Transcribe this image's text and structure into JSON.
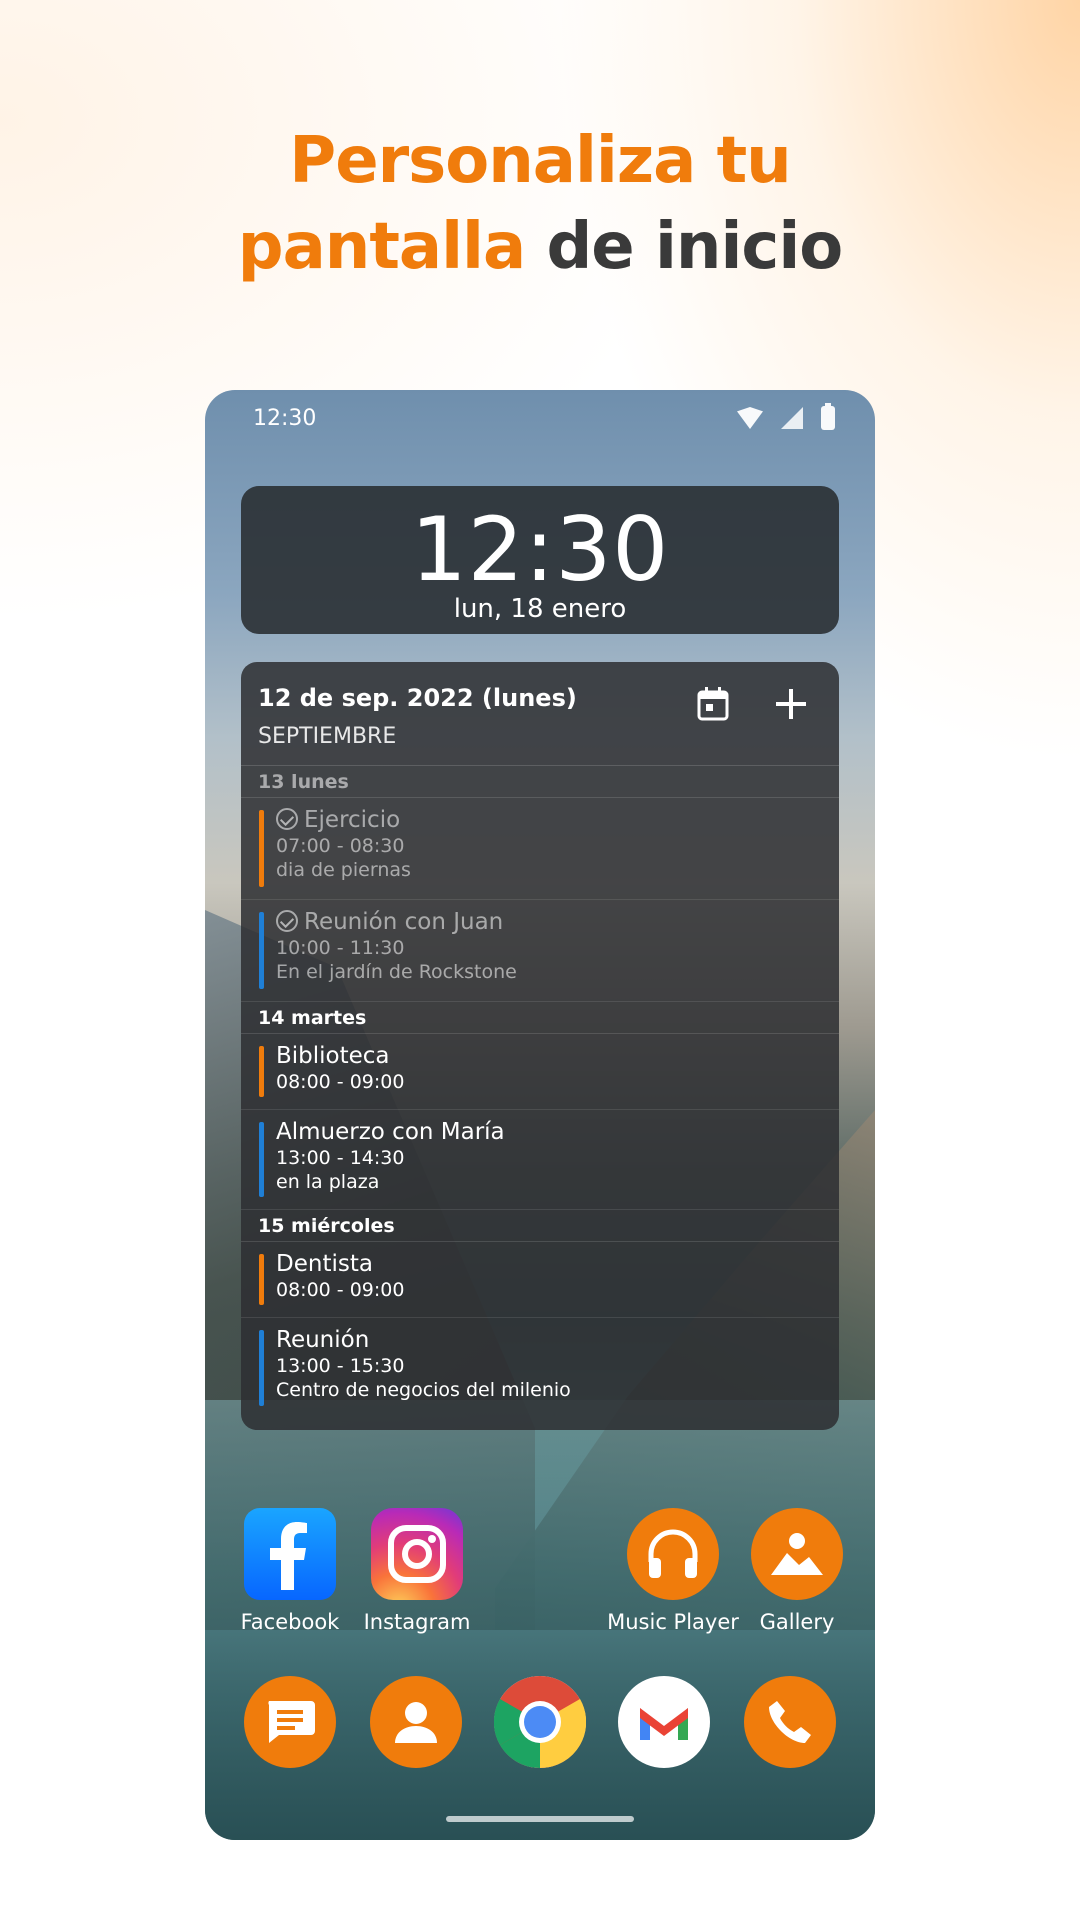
{
  "headline": {
    "line1_orange": "Personaliza tu",
    "line2_orange": "pantalla",
    "line2_dark": "de inicio"
  },
  "colors": {
    "accent": "#f07c0c",
    "dark_text": "#3a3a3a",
    "event_orange": "#f07c0c",
    "event_blue": "#1f7fd6"
  },
  "status_bar": {
    "time": "12:30",
    "icons": [
      "wifi-icon",
      "signal-icon",
      "battery-icon"
    ]
  },
  "clock_widget": {
    "time": "12:30",
    "date": "lun, 18 enero"
  },
  "calendar": {
    "title": "12 de sep. 2022 (lunes)",
    "month": "SEPTIEMBRE",
    "days": [
      {
        "label": "13 lunes",
        "events": [
          {
            "title": "Ejercicio",
            "time": "07:00 - 08:30",
            "note": "dia de piernas",
            "completed": true
          },
          {
            "title": "Reunión con Juan",
            "time": "10:00 - 11:30",
            "note": "En el jardín de Rockstone",
            "completed": true
          }
        ]
      },
      {
        "label": "14 martes",
        "events": [
          {
            "title": "Biblioteca",
            "time": "08:00 - 09:00",
            "note": ""
          },
          {
            "title": "Almuerzo con María",
            "time": "13:00 - 14:30",
            "note": "en la plaza"
          }
        ]
      },
      {
        "label": "15 miércoles",
        "events": [
          {
            "title": "Dentista",
            "time": "08:00 - 09:00",
            "note": ""
          },
          {
            "title": "Reunión",
            "time": "13:00 - 15:30",
            "note": "Centro de negocios del milenio"
          }
        ]
      }
    ]
  },
  "apps": [
    {
      "label": "Facebook"
    },
    {
      "label": "Instagram"
    },
    {
      "label": "Music Player"
    },
    {
      "label": "Gallery"
    }
  ],
  "dock": [
    "messages-icon",
    "contacts-icon",
    "chrome-icon",
    "gmail-icon",
    "phone-icon"
  ]
}
